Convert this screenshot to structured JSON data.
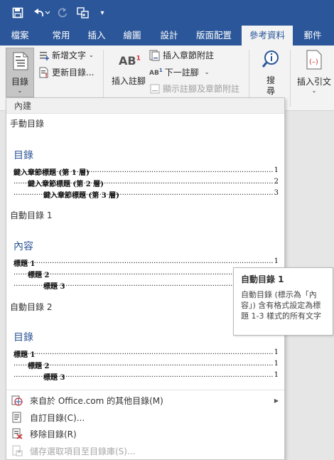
{
  "quick_access": {
    "icons": [
      "save-icon",
      "undo-icon",
      "redo-icon",
      "touch-mode-icon",
      "customize-qat-icon"
    ],
    "customize_glyph": "▾"
  },
  "tabs": [
    {
      "label": "檔案",
      "active": false
    },
    {
      "label": "常用",
      "active": false
    },
    {
      "label": "插入",
      "active": false
    },
    {
      "label": "繪圖",
      "active": false
    },
    {
      "label": "設計",
      "active": false
    },
    {
      "label": "版面配置",
      "active": false
    },
    {
      "label": "參考資料",
      "active": true
    },
    {
      "label": "郵件",
      "active": false
    }
  ],
  "ribbon": {
    "toc_button": "目錄",
    "add_text": "新增文字",
    "update_table": "更新目錄...",
    "insert_footnote": "插入註腳",
    "insert_endnote": "插入章節附註",
    "next_footnote": "下一註腳",
    "show_notes": "顯示註腳及章節附註",
    "search": "搜\n尋",
    "insert_citation": "插入引文",
    "footnote_icon_text": "AB",
    "footnote_icon_sup": "1",
    "next_icon_text": "AB",
    "next_icon_sup": "1"
  },
  "menu": {
    "header": "內建",
    "manual_title": "手動目錄",
    "gallery": [
      {
        "heading": "目錄",
        "lines": [
          {
            "text": "鍵入章節標題 (第 1 層)",
            "page": "1",
            "indent": 0
          },
          {
            "text": "鍵入章節標題 (第 2 層)",
            "page": "2",
            "indent": 1
          },
          {
            "text": "鍵入章節標題 (第 3 層)",
            "page": "3",
            "indent": 2
          }
        ]
      },
      {
        "title": "自動目錄 1",
        "heading": "內容",
        "lines": [
          {
            "text": "標題 1",
            "page": "1",
            "indent": 0
          },
          {
            "text": "標題 2",
            "page": "1",
            "indent": 1
          },
          {
            "text": "標題 3",
            "page": "1",
            "indent": 2
          }
        ]
      },
      {
        "title": "自動目錄 2",
        "heading": "目錄",
        "lines": [
          {
            "text": "標題 1",
            "page": "1",
            "indent": 0
          },
          {
            "text": "標題 2",
            "page": "1",
            "indent": 1
          },
          {
            "text": "標題 3",
            "page": "1",
            "indent": 2
          }
        ]
      }
    ],
    "commands": [
      {
        "label": "來自於 Office.com 的其他目錄(M)",
        "icon": "office-globe-icon",
        "submenu": true,
        "disabled": false
      },
      {
        "label": "自訂目錄(C)...",
        "icon": "custom-toc-icon",
        "submenu": false,
        "disabled": false
      },
      {
        "label": "移除目錄(R)",
        "icon": "remove-toc-icon",
        "submenu": false,
        "disabled": false
      },
      {
        "label": "儲存選取項目至目錄庫(S)...",
        "icon": "save-selection-icon",
        "submenu": false,
        "disabled": true
      }
    ],
    "submenu_glyph": "▶"
  },
  "tooltip": {
    "title": "自動目錄 1",
    "body": "自動目錄 (標示為「內容」) 含有格式設定為標題 1-3 樣式的所有文字"
  },
  "colors": {
    "title_bar": "#2b579a",
    "ribbon": "#f3f3f3",
    "toc_heading": "#2e5597"
  }
}
